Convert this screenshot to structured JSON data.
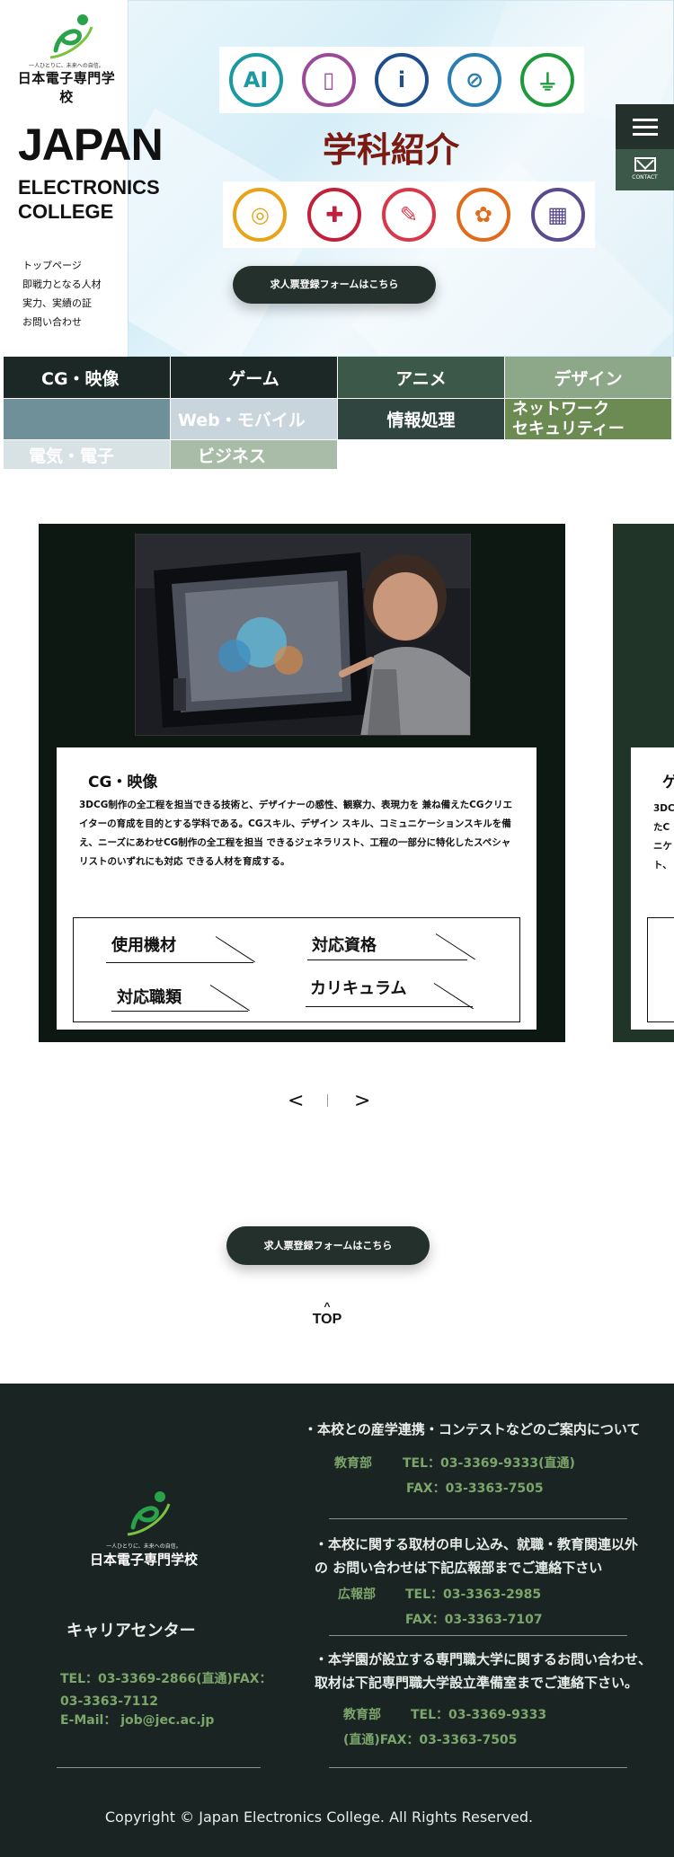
{
  "header": {
    "logo_tagline": "一人ひとりに、未来への自信。",
    "logo_name": "日本電子専門学校",
    "brand_line1": "JAPAN",
    "brand_line2": "ELECTRONICS",
    "brand_line3": "COLLEGE",
    "side_links": [
      "トップページ",
      "即戦力となる人材",
      "実力、実績の証",
      "お問い合わせ"
    ],
    "hero_title": "学科紹介",
    "cta_label": "求人票登録フォームはこちら",
    "contact_label": "CONTACT",
    "icons_top": [
      {
        "name": "ai-icon",
        "glyph": "AI",
        "color": "#1a9aa0"
      },
      {
        "name": "smartphone-icon",
        "glyph": "▯",
        "color": "#9b4a9a"
      },
      {
        "name": "info-icon",
        "glyph": "i",
        "color": "#1f4e8c"
      },
      {
        "name": "network-icon",
        "glyph": "⊘",
        "color": "#2a7eb0"
      },
      {
        "name": "plug-icon",
        "glyph": "⏚",
        "color": "#1e9a3c"
      }
    ],
    "icons_bottom": [
      {
        "name": "globe-icon",
        "glyph": "◎",
        "color": "#e8a419"
      },
      {
        "name": "gamepad-icon",
        "glyph": "✚",
        "color": "#c21f3a"
      },
      {
        "name": "pencil-icon",
        "glyph": "✎",
        "color": "#d8384a"
      },
      {
        "name": "palette-icon",
        "glyph": "✿",
        "color": "#e06b1a"
      },
      {
        "name": "calculator-icon",
        "glyph": "▦",
        "color": "#5b4a8e"
      }
    ]
  },
  "categories": [
    {
      "label": "CG・映像",
      "color": "#1c2825"
    },
    {
      "label": "ゲーム",
      "color": "#1c2825"
    },
    {
      "label": "アニメ",
      "color": "#3c5848"
    },
    {
      "label": "デザイン",
      "color": "#8da888"
    },
    {
      "label": "",
      "color": "#6f8f99"
    },
    {
      "label": "Web・モバイル",
      "color": "#c9d5dc"
    },
    {
      "label": "情報処理",
      "color": "#304440"
    },
    {
      "label": "ネットワーク\nセキュリティー",
      "color": "#6b8b52"
    },
    {
      "label": "電気・電子",
      "color": "#d8e1e4"
    },
    {
      "label": "ビジネス",
      "color": "#a9bca8"
    }
  ],
  "slide": {
    "title": "CG・映像",
    "description": "3DCG制作の全工程を担当できる技術と、デザイナーの感性、観察力、表現力を 兼ね備えたCGクリエイターの育成を目的とする学科である。CGスキル、デザイン スキル、コミュニケーションスキルを備え、ニーズにあわせCG制作の全工程を担当 できるジェネラリスト、工程の一部分に特化したスペシャリストのいずれにも対応 できる人材を育成する。",
    "links": [
      "使用機材",
      "対応資格",
      "対応職類",
      "カリキュラム"
    ],
    "next_peek_title": "ゲ",
    "next_peek_text": [
      "3DC",
      "たC",
      "ニケ",
      "ト、"
    ]
  },
  "pager": {
    "prev": "<",
    "next": ">"
  },
  "cta_bottom": "求人票登録フォームはこちら",
  "top_link": {
    "caret": "^",
    "label": "TOP"
  },
  "footer": {
    "logo_tagline": "一人ひとりに、未来への自信。",
    "logo_name": "日本電子専門学校",
    "career_center": "キャリアセンター",
    "career_tel": "TEL：03-3369-2866(直通)FAX：",
    "career_fax": "03-3363-7112",
    "career_email": "E-Mail： job@jec.ac.jp",
    "block1_heading": "・本校との産学連携・コンテストなどのご案内について",
    "block1_dept": "教育部",
    "block1_tel": "TEL：03-3369-9333(直通)",
    "block1_fax": "FAX：03-3363-7505",
    "block2_heading1": "・本校に関する取材の申し込み、就職・教育関連以外",
    "block2_heading2": "の お問い合わせは下記広報部までご連絡下さい",
    "block2_dept": "広報部",
    "block2_tel": "TEL：03-3363-2985",
    "block2_fax": "FAX：03-3363-7107",
    "block3_heading1": "・本学園が設立する専門職大学に関するお問い合わせ、",
    "block3_heading2": "取材は下記専門職大学設立準備室までご連絡下さい。",
    "block3_dept": "教育部",
    "block3_tel": "TEL：03-3369-9333",
    "block3_fax": "(直通)FAX：03-3363-7505",
    "copyright": "Copyright © Japan Electronics College. All Rights Reserved."
  }
}
